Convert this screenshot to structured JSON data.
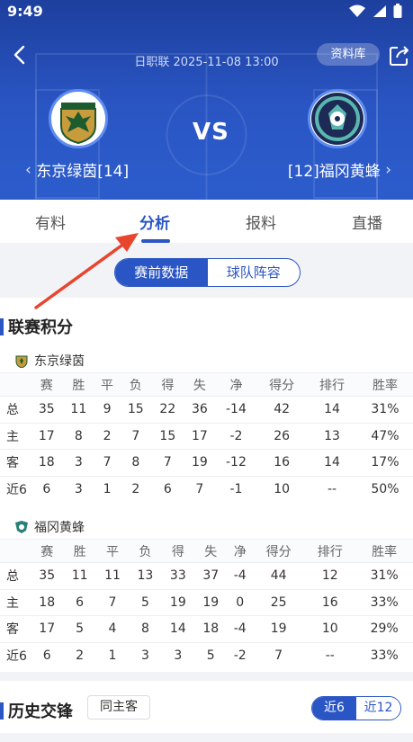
{
  "status_bar": {
    "time": "9:49"
  },
  "header": {
    "league_datetime": "日职联 2025-11-08 13:00",
    "database_button": "资料库",
    "vs_label": "VS",
    "home_team": {
      "name": "东京绿茵[14]",
      "logo_text": "TOKYO VERDY"
    },
    "away_team": {
      "name": "[12]福冈黄蜂"
    }
  },
  "tabs": [
    {
      "label": "有料",
      "active": false
    },
    {
      "label": "分析",
      "active": true
    },
    {
      "label": "报料",
      "active": false
    },
    {
      "label": "直播",
      "active": false
    }
  ],
  "segment": {
    "selected": "赛前数据",
    "other": "球队阵容"
  },
  "standings": {
    "title": "联赛积分",
    "columns": [
      "",
      "赛",
      "胜",
      "平",
      "负",
      "得",
      "失",
      "净",
      "得分",
      "排行",
      "胜率"
    ],
    "teams": [
      {
        "name": "东京绿茵",
        "rows": [
          [
            "总",
            "35",
            "11",
            "9",
            "15",
            "22",
            "36",
            "-14",
            "42",
            "14",
            "31%"
          ],
          [
            "主",
            "17",
            "8",
            "2",
            "7",
            "15",
            "17",
            "-2",
            "26",
            "13",
            "47%"
          ],
          [
            "客",
            "18",
            "3",
            "7",
            "8",
            "7",
            "19",
            "-12",
            "16",
            "14",
            "17%"
          ],
          [
            "近6",
            "6",
            "3",
            "1",
            "2",
            "6",
            "7",
            "-1",
            "10",
            "--",
            "50%"
          ]
        ]
      },
      {
        "name": "福冈黄蜂",
        "rows": [
          [
            "总",
            "35",
            "11",
            "11",
            "13",
            "33",
            "37",
            "-4",
            "44",
            "12",
            "31%"
          ],
          [
            "主",
            "18",
            "6",
            "7",
            "5",
            "19",
            "19",
            "0",
            "25",
            "16",
            "33%"
          ],
          [
            "客",
            "17",
            "5",
            "4",
            "8",
            "14",
            "18",
            "-4",
            "19",
            "10",
            "29%"
          ],
          [
            "近6",
            "6",
            "2",
            "1",
            "3",
            "3",
            "5",
            "-2",
            "7",
            "--",
            "33%"
          ]
        ]
      }
    ]
  },
  "history": {
    "title": "历史交锋",
    "same_host_button": "同主客",
    "toggle": {
      "selected": "近6",
      "other": "近12"
    }
  },
  "colors": {
    "primary": "#2a55c5",
    "header_top": "#1d3f9e",
    "arrow": "#e8452f"
  }
}
